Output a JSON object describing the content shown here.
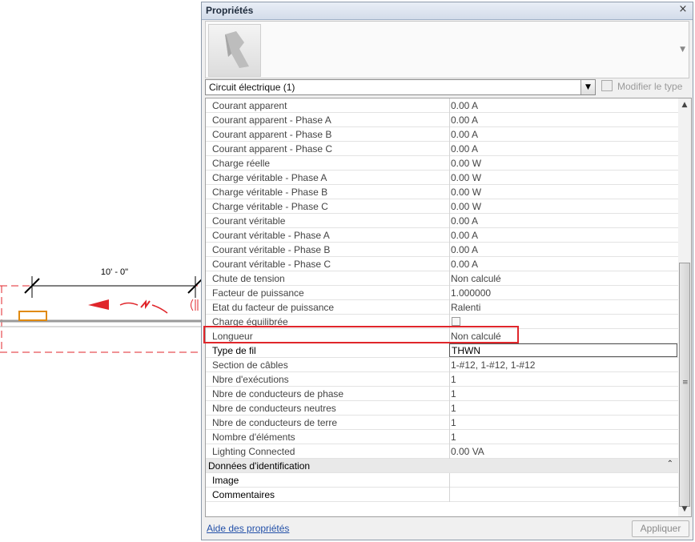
{
  "drawing": {
    "dimension_text": "10' - 0\""
  },
  "palette": {
    "title": "Propriétés",
    "close_glyph": "×",
    "type_selector": {
      "scroll_glyph": "▼"
    },
    "category_select": {
      "value": "Circuit électrique (1)"
    },
    "edit_type_button": {
      "label": "Modifier le type"
    },
    "rows": [
      {
        "name": "Courant apparent",
        "value": "0.00 A"
      },
      {
        "name": "Courant apparent - Phase A",
        "value": "0.00 A"
      },
      {
        "name": "Courant apparent - Phase B",
        "value": "0.00 A"
      },
      {
        "name": "Courant apparent - Phase C",
        "value": "0.00 A"
      },
      {
        "name": "Charge réelle",
        "value": "0.00 W"
      },
      {
        "name": "Charge véritable - Phase A",
        "value": "0.00 W"
      },
      {
        "name": "Charge véritable - Phase B",
        "value": "0.00 W"
      },
      {
        "name": "Charge véritable - Phase C",
        "value": "0.00 W"
      },
      {
        "name": "Courant véritable",
        "value": "0.00 A"
      },
      {
        "name": "Courant véritable - Phase A",
        "value": "0.00 A"
      },
      {
        "name": "Courant véritable - Phase B",
        "value": "0.00 A"
      },
      {
        "name": "Courant véritable - Phase C",
        "value": "0.00 A"
      },
      {
        "name": "Chute de tension",
        "value": "Non calculé"
      },
      {
        "name": "Facteur de puissance",
        "value": "1.000000"
      },
      {
        "name": "Etat du facteur de puissance",
        "value": "Ralenti"
      },
      {
        "name": "Charge équilibrée",
        "value": ""
      },
      {
        "name": "Longueur",
        "value": "Non calculé"
      },
      {
        "name": "Type de fil",
        "value": "THWN"
      },
      {
        "name": "Section de câbles",
        "value": "1-#12, 1-#12, 1-#12"
      },
      {
        "name": "Nbre d'exécutions",
        "value": "1"
      },
      {
        "name": "Nbre de conducteurs de phase",
        "value": "1"
      },
      {
        "name": "Nbre de conducteurs neutres",
        "value": "1"
      },
      {
        "name": "Nbre de conducteurs de terre",
        "value": "1"
      },
      {
        "name": "Nombre d'éléments",
        "value": "1"
      },
      {
        "name": "Lighting Connected",
        "value": "0.00 VA"
      }
    ],
    "identity_group": {
      "title": "Données d'identification",
      "collapse_glyph": "⌃",
      "rows": [
        {
          "name": "Image",
          "value": ""
        },
        {
          "name": "Commentaires",
          "value": ""
        }
      ]
    },
    "scroll_up_glyph": "▲",
    "scroll_down_glyph": "▼",
    "help_link": "Aide des propriétés",
    "apply_button": "Appliquer"
  },
  "colors": {
    "highlight_border": "#e0262b",
    "drawing_red": "#e0262b",
    "drawing_orange": "#e08a10"
  }
}
